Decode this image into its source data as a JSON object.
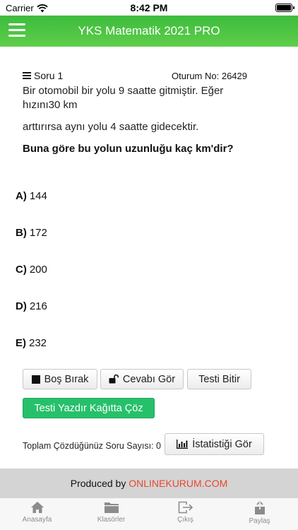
{
  "status_bar": {
    "carrier": "Carrier",
    "time": "8:42 PM"
  },
  "header": {
    "title": "YKS Matematik 2021 PRO"
  },
  "question": {
    "label": "Soru 1",
    "session": "Oturum No: 26429",
    "text_line1": "Bir otomobil bir yolu 9 saatte gitmiştir. Eğer",
    "text_line2": "hızını30 km",
    "text_line3": "arttırırsa aynı yolu 4 saatte gidecektir.",
    "prompt": "Buna göre bu yolun uzunluğu kaç km'dir?"
  },
  "options": [
    {
      "letter": "A)",
      "value": "144"
    },
    {
      "letter": "B)",
      "value": "172"
    },
    {
      "letter": "C)",
      "value": "200"
    },
    {
      "letter": "D)",
      "value": "216"
    },
    {
      "letter": "E)",
      "value": "232"
    }
  ],
  "actions": {
    "skip": "Boş Bırak",
    "show_answer": "Cevabı Gör",
    "finish": "Testi Bitir",
    "print": "Testi Yazdır Kağıtta Çöz",
    "stats": "İstatistiği Gör",
    "total_label": "Toplam Çözdüğünüz Soru Sayısı: 0"
  },
  "footer": {
    "produced_by": "Produced by ",
    "brand": "ONLINEKURUM.COM"
  },
  "tabs": [
    {
      "label": "Anasayfa",
      "icon": "home-icon"
    },
    {
      "label": "Klasörler",
      "icon": "folder-icon"
    },
    {
      "label": "Çıkış",
      "icon": "logout-icon"
    },
    {
      "label": "Paylaş",
      "icon": "share-icon"
    }
  ],
  "colors": {
    "header_green": "#4cc443",
    "print_green": "#26c06a",
    "brand_red": "#e8472c"
  }
}
